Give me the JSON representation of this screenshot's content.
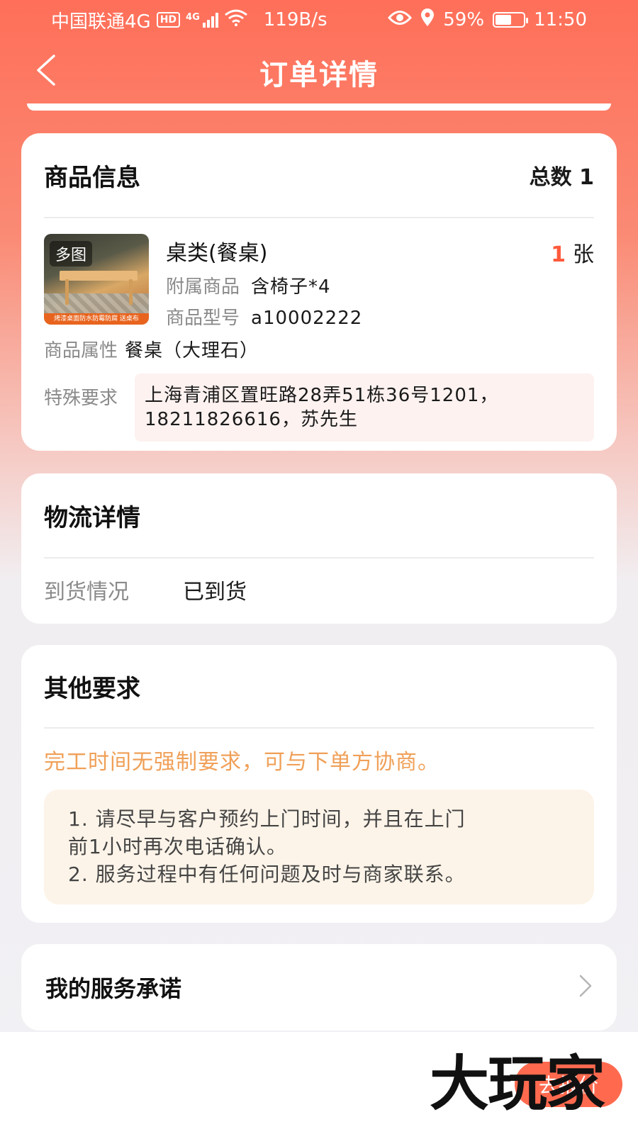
{
  "status_bar": {
    "carrier": "中国联通4G",
    "hd_badge": "HD",
    "net_type": "4G",
    "speed": "119B/s",
    "battery": "59%",
    "battery_level": 0.59,
    "time": "11:50",
    "icons": [
      "hd-icon",
      "signal-icon",
      "wifi-icon",
      "eye-icon",
      "location-icon",
      "battery-icon"
    ]
  },
  "nav": {
    "title": "订单详情",
    "back_icon": "chevron-left-icon"
  },
  "product": {
    "section_title": "商品信息",
    "total_label": "总数 1",
    "thumbnail_badge": "多图",
    "thumbnail_banner": "烤漆桌面防水防霉防腐 送桌布",
    "name": "桌类(餐桌)",
    "quantity": "1",
    "quantity_unit": "张",
    "accessory_label": "附属商品",
    "accessory_value": "含椅子*4",
    "model_label": "商品型号",
    "model_value": "a10002222",
    "attribute_label": "商品属性",
    "attribute_value": "餐桌（大理石）",
    "special_label": "特殊要求",
    "special_line1": "上海青浦区置旺路28弄51栋36号1201，",
    "special_line2": "18211826616，苏先生"
  },
  "logistics": {
    "section_title": "物流详情",
    "arrival_label": "到货情况",
    "arrival_value": "已到货"
  },
  "other": {
    "section_title": "其他要求",
    "notice": "完工时间无强制要求，可与下单方协商。",
    "tip1_line1": "1. 请尽早与客户预约上门时间，并且在上门",
    "tip1_line2": "前1小时再次电话确认。",
    "tip2": "2. 服务过程中有任何问题及时与商家联系。"
  },
  "service": {
    "title": "我的服务承诺",
    "icon": "chevron-right-icon"
  },
  "bottom": {
    "button_label": "去报价"
  },
  "watermark": "大玩家",
  "colors": {
    "header": "#ff6f59",
    "accent": "#ff5a3c",
    "notice": "#f0a058"
  }
}
